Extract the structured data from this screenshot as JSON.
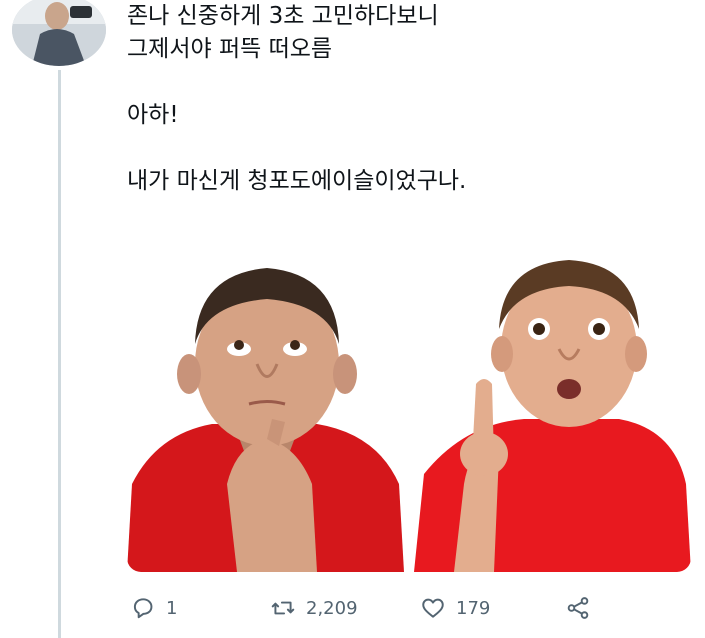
{
  "tweet": {
    "text": "존나 신중하게 3초 고민하다보니\n그제서야 퍼뜩 떠오름\n\n아하!\n\n내가 마신게 청포도에이슬이었구나."
  },
  "actions": {
    "reply_count": "1",
    "retweet_count": "2,209",
    "like_count": "179"
  },
  "icons": {
    "reply": "reply-icon",
    "retweet": "retweet-icon",
    "like": "heart-icon",
    "share": "share-icon"
  }
}
